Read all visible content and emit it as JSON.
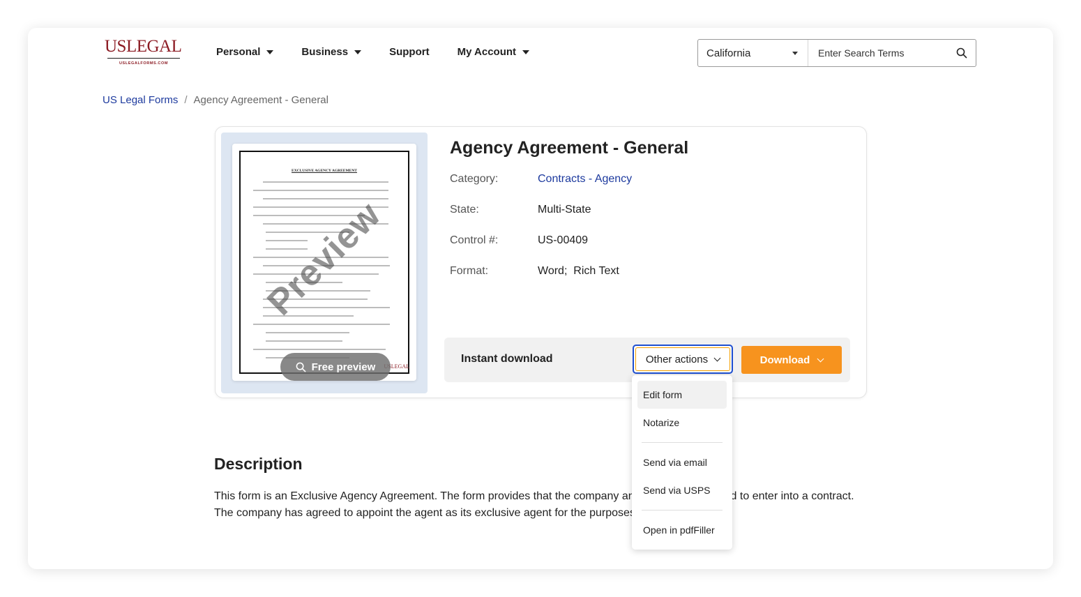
{
  "brand": {
    "logo_text": "USLEGAL",
    "logo_subtext": "USLEGALFORMS.COM",
    "color": "#8c1c24"
  },
  "nav": {
    "items": [
      {
        "label": "Personal",
        "has_caret": true
      },
      {
        "label": "Business",
        "has_caret": true
      },
      {
        "label": "Support",
        "has_caret": false
      },
      {
        "label": "My Account",
        "has_caret": true
      }
    ]
  },
  "search": {
    "state": "California",
    "placeholder": "Enter Search Terms"
  },
  "breadcrumb": {
    "root": "US Legal Forms",
    "separator": "/",
    "current": "Agency Agreement - General"
  },
  "form": {
    "title": "Agency Agreement - General",
    "meta": [
      {
        "label": "Category:",
        "value": "Contracts - Agency",
        "is_link": true
      },
      {
        "label": "State:",
        "value": "Multi-State",
        "is_link": false
      },
      {
        "label": "Control #:",
        "value": "US-00409",
        "is_link": false
      },
      {
        "label": "Format:",
        "value": "Word;  Rich Text",
        "is_link": false
      }
    ]
  },
  "preview": {
    "doc_title": "EXCLUSIVE AGENCY AGREEMENT",
    "watermark": "Preview",
    "paper_logo": "USLEGAL",
    "button_label": "Free preview"
  },
  "actions": {
    "instant_label": "Instant download",
    "other_label": "Other actions",
    "download_label": "Download",
    "download_color": "#f7931e",
    "focus_color": "#1e4fd0"
  },
  "menu": {
    "items": [
      {
        "label": "Edit form"
      },
      {
        "label": "Notarize"
      },
      {
        "label": "Send via email"
      },
      {
        "label": "Send via USPS"
      },
      {
        "label": "Open in pdfFiller"
      }
    ]
  },
  "description": {
    "heading": "Description",
    "text": "This form is an Exclusive Agency Agreement. The form provides that the company and agent have agreed to enter into a contract. The company has agreed to appoint the agent as its exclusive agent for the purposes listed in the form."
  }
}
